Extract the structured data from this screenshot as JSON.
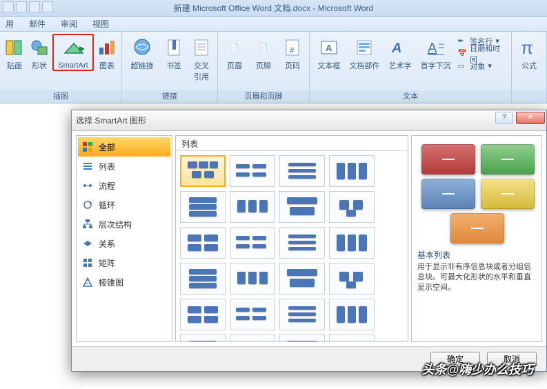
{
  "titlebar": {
    "text": "新建 Microsoft Office Word 文档.docx - Microsoft Word"
  },
  "tabs": {
    "t1": "用",
    "t2": "邮件",
    "t3": "审阅",
    "t4": "视图"
  },
  "ribbon": {
    "group_illust": "插图",
    "group_links": "链接",
    "group_hf": "页眉和页脚",
    "group_text": "文本",
    "btn_clipart": "贴画",
    "btn_shapes": "形状",
    "btn_smartart": "SmartArt",
    "btn_chart": "图表",
    "btn_hyperlink": "超链接",
    "btn_bookmark": "书签",
    "btn_crossref1": "交叉",
    "btn_crossref2": "引用",
    "btn_header": "页眉",
    "btn_footer": "页脚",
    "btn_pagenum": "页码",
    "btn_textbox": "文本框",
    "btn_quickparts": "文档部件",
    "btn_wordart": "艺术字",
    "btn_dropcap": "首字下沉",
    "btn_sigline": "签名行",
    "btn_datetime": "日期和时间",
    "btn_object": "对象",
    "btn_equation": "公式"
  },
  "dialog": {
    "title": "选择 SmartArt 图形",
    "categories": {
      "all": "全部",
      "list": "列表",
      "process": "流程",
      "cycle": "循环",
      "hierarchy": "层次结构",
      "relationship": "关系",
      "matrix": "矩阵",
      "pyramid": "棱锥图"
    },
    "gallery_head": "列表",
    "preview_title": "基本列表",
    "preview_desc": "用于显示非有序信息块或者分组信息块。可最大化形状的水平和垂直显示空间。",
    "ok": "确定",
    "cancel": "取消"
  },
  "watermark": "头条@嗨少办么技巧"
}
